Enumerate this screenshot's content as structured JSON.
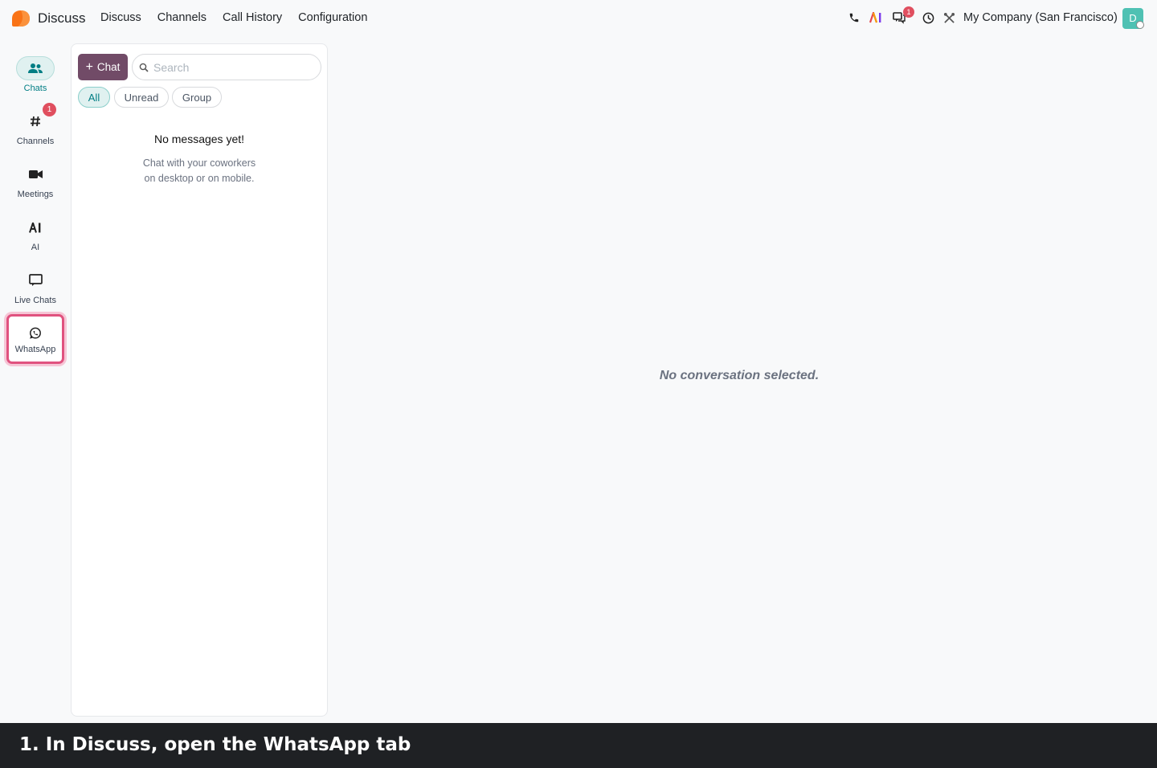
{
  "app": {
    "name": "Discuss"
  },
  "nav": {
    "items": [
      "Discuss",
      "Channels",
      "Call History",
      "Configuration"
    ]
  },
  "systray": {
    "messages_badge": "1",
    "company": "My Company (San Francisco)",
    "avatar_initial": "D"
  },
  "rail": {
    "items": [
      {
        "label": "Chats",
        "icon": "users-icon"
      },
      {
        "label": "Channels",
        "icon": "hash-icon",
        "badge": "1"
      },
      {
        "label": "Meetings",
        "icon": "video-camera-icon"
      },
      {
        "label": "AI",
        "icon": "ai-icon"
      },
      {
        "label": "Live Chats",
        "icon": "chat-bubble-icon"
      },
      {
        "label": "WhatsApp",
        "icon": "whatsapp-icon"
      }
    ]
  },
  "sidebar": {
    "new_chat_label": "Chat",
    "search_placeholder": "Search",
    "filters": [
      "All",
      "Unread",
      "Group"
    ],
    "empty_title": "No messages yet!",
    "empty_line1": "Chat with your coworkers",
    "empty_line2": "on desktop or on mobile."
  },
  "main": {
    "empty_text": "No conversation selected."
  },
  "caption": {
    "text": "1. In Discuss, open the WhatsApp tab"
  },
  "colors": {
    "brand": "#714b67",
    "accent": "#017e84",
    "highlight": "#e0527f",
    "badge": "#e04f5f"
  }
}
